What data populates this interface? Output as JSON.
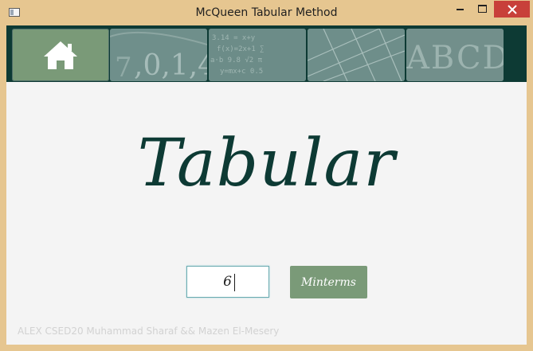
{
  "window": {
    "title": "McQueen Tabular Method"
  },
  "navbar": {
    "tiles": [
      {
        "icon": "home-icon"
      },
      {
        "icon": "numbers-tile-icon"
      },
      {
        "icon": "formula-tile-icon"
      },
      {
        "icon": "grid-tile-icon"
      },
      {
        "icon": "letters-tile-icon"
      }
    ]
  },
  "main": {
    "heading": "Tabular",
    "input_value": "6",
    "button_label": "Minterms"
  },
  "footer": {
    "credit": "ALEX CSED20 Muhammad Sharaf && Mazen El-Mesery"
  },
  "colors": {
    "frame": "#e6c690",
    "nav_bg": "#0d3a34",
    "accent": "#7a9a78",
    "heading": "#0d3a34"
  }
}
